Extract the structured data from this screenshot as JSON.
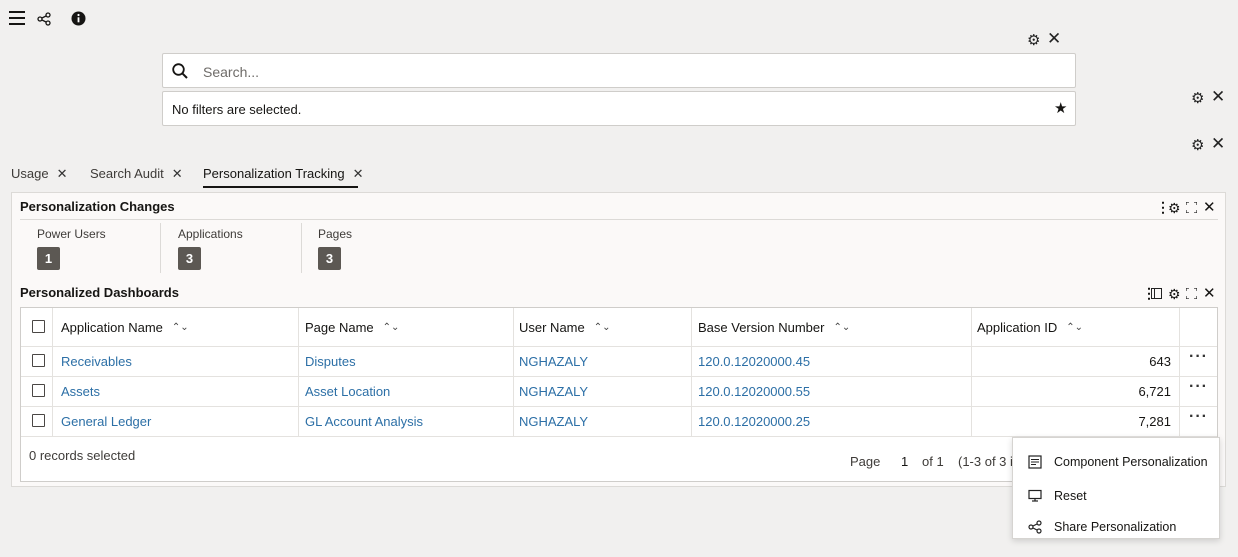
{
  "toolbar": {
    "menu_icon": "hamburger-icon",
    "share_icon": "share-icon",
    "info_icon": "info-icon"
  },
  "search": {
    "placeholder": "Search...",
    "value": ""
  },
  "filters": {
    "text": "No filters are selected."
  },
  "tabs": [
    {
      "label": "Usage"
    },
    {
      "label": "Search Audit"
    },
    {
      "label": "Personalization Tracking"
    }
  ],
  "panel": {
    "title": "Personalization Changes",
    "metrics": [
      {
        "label": "Power Users",
        "value": "1"
      },
      {
        "label": "Applications",
        "value": "3"
      },
      {
        "label": "Pages",
        "value": "3"
      }
    ]
  },
  "dashboards": {
    "title": "Personalized Dashboards",
    "columns": [
      "Application Name",
      "Page Name",
      "User Name",
      "Base Version Number",
      "Application ID"
    ],
    "rows": [
      {
        "app": "Receivables",
        "page": "Disputes",
        "user": "NGHAZALY",
        "version": "120.0.12020000.45",
        "id": "643"
      },
      {
        "app": "Assets",
        "page": "Asset Location",
        "user": "NGHAZALY",
        "version": "120.0.12020000.55",
        "id": "6,721"
      },
      {
        "app": "General Ledger",
        "page": "GL Account Analysis",
        "user": "NGHAZALY",
        "version": "120.0.12020000.25",
        "id": "7,281"
      }
    ],
    "footer": {
      "selected": "0 records selected",
      "page_label": "Page",
      "page_value": "1",
      "of_label": "of 1",
      "range": "(1-3 of 3 it"
    }
  },
  "context_menu": {
    "items": [
      {
        "label": "Component Personalization",
        "icon": "component-personalization-icon"
      },
      {
        "label": "Reset",
        "icon": "reset-icon"
      },
      {
        "label": "Share Personalization",
        "icon": "share-icon"
      }
    ]
  }
}
